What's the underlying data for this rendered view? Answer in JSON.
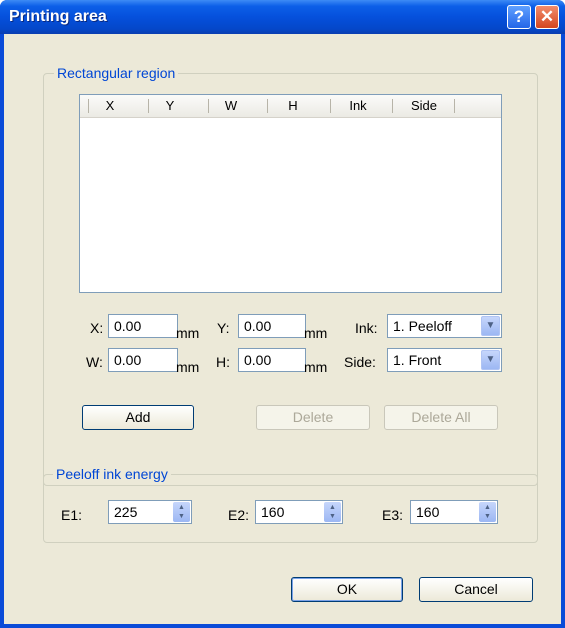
{
  "window": {
    "title": "Printing area",
    "help_glyph": "?",
    "close_glyph": "✕"
  },
  "rect_group": {
    "legend": "Rectangular region",
    "columns": [
      "X",
      "Y",
      "W",
      "H",
      "Ink",
      "Side"
    ],
    "rows": []
  },
  "fields": {
    "x_label": "X:",
    "x_value": "0.00",
    "x_unit": "mm",
    "y_label": "Y:",
    "y_value": "0.00",
    "y_unit": "mm",
    "w_label": "W:",
    "w_value": "0.00",
    "w_unit": "mm",
    "h_label": "H:",
    "h_value": "0.00",
    "h_unit": "mm",
    "ink_label": "Ink:",
    "ink_value": "1. Peeloff",
    "side_label": "Side:",
    "side_value": "1. Front"
  },
  "buttons": {
    "add": "Add",
    "delete": "Delete",
    "delete_all": "Delete All",
    "ok": "OK",
    "cancel": "Cancel"
  },
  "energy_group": {
    "legend": "Peeloff ink energy",
    "e1_label": "E1:",
    "e1_value": "225",
    "e2_label": "E2:",
    "e2_value": "160",
    "e3_label": "E3:",
    "e3_value": "160"
  },
  "colors": {
    "title_bar": "#0550dc",
    "dialog_bg": "#ece9d8",
    "legend_text": "#0046d5"
  }
}
